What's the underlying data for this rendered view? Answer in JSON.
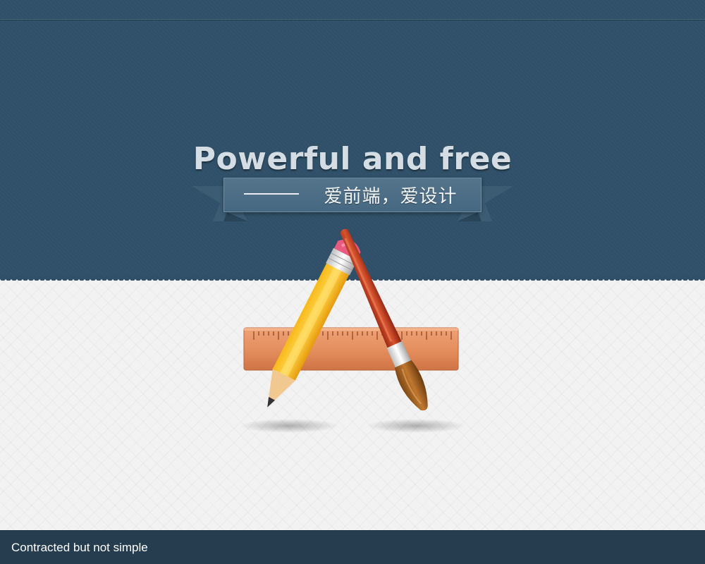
{
  "hero": {
    "headline": "Powerful and free",
    "ribbon_text": "爱前端，爱设计"
  },
  "icon": {
    "name": "design-tools-icon"
  },
  "footer": {
    "text": "Contracted but not simple"
  },
  "colors": {
    "hero_bg": "#2f5068",
    "ribbon_bg": "#4e6f86",
    "footer_bg": "#253d4f",
    "light_bg": "#f2f2f2"
  }
}
